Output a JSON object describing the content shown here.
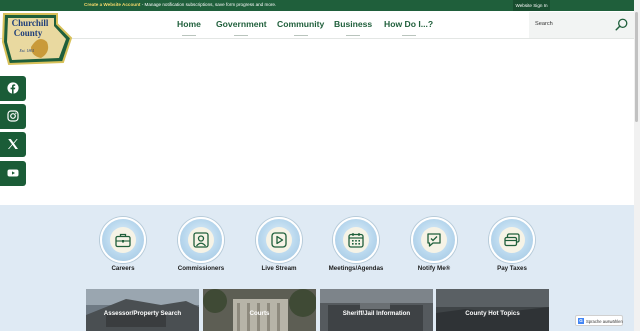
{
  "topbar": {
    "create_account": "Create a Website Account",
    "message": " - Manage notification subscriptions, save form progress and more.",
    "signin": "Website Sign In"
  },
  "logo": {
    "line1": "Churchill",
    "line2": "County",
    "est": "Est. 1861"
  },
  "nav": [
    {
      "label": "Home"
    },
    {
      "label": "Government"
    },
    {
      "label": "Community"
    },
    {
      "label": "Business"
    },
    {
      "label": "How Do I...?"
    }
  ],
  "search": {
    "placeholder": "Search",
    "icon": "search-icon"
  },
  "social": [
    {
      "name": "facebook-icon"
    },
    {
      "name": "instagram-icon"
    },
    {
      "name": "x-twitter-icon"
    },
    {
      "name": "youtube-icon"
    }
  ],
  "quick_links": [
    {
      "label": "Careers",
      "icon": "briefcase-icon"
    },
    {
      "label": "Commissioners",
      "icon": "person-icon"
    },
    {
      "label": "Live Stream",
      "icon": "play-icon"
    },
    {
      "label": "Meetings/Agendas",
      "icon": "calendar-icon"
    },
    {
      "label": "Notify Me®",
      "icon": "chat-check-icon"
    },
    {
      "label": "Pay Taxes",
      "icon": "cards-icon"
    }
  ],
  "tiles": [
    {
      "label": "Assessor/Property Search"
    },
    {
      "label": "Courts"
    },
    {
      "label": "Sheriff/Jail Information"
    },
    {
      "label": "County Hot Topics"
    }
  ],
  "translate": {
    "label": "Sprache auswählen"
  },
  "colors": {
    "brand_green": "#1f5f3b",
    "lower_bg": "#dfeaf4"
  }
}
